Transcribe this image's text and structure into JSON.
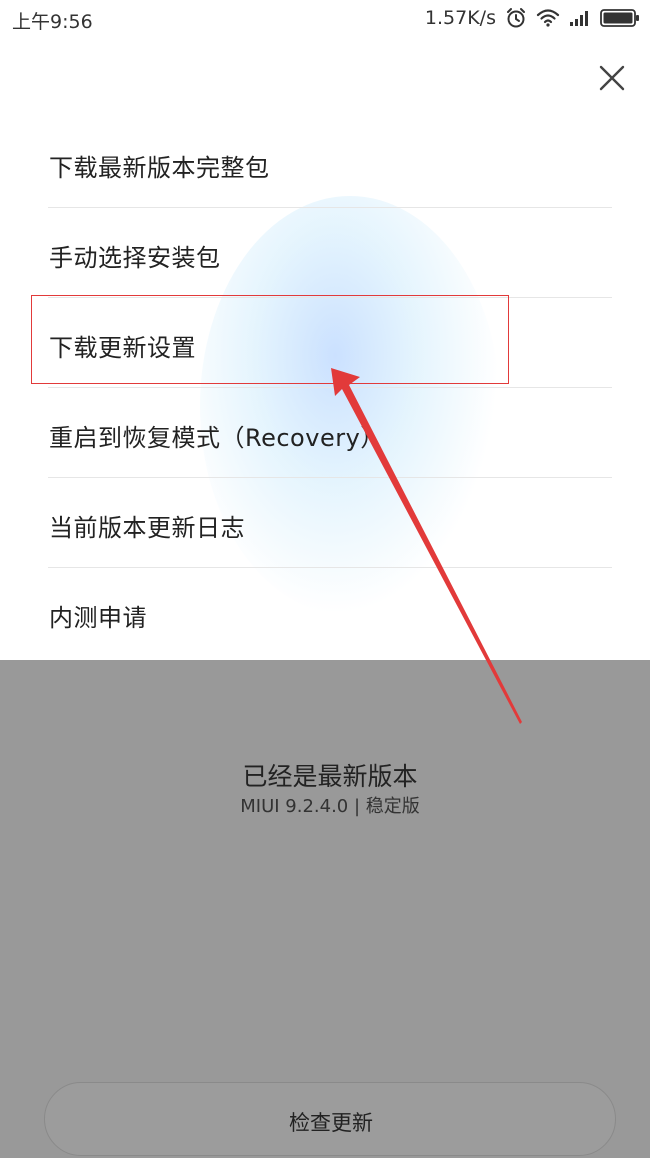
{
  "status_bar": {
    "time": "上午9:56",
    "network_speed": "1.57K/s",
    "icons": [
      "alarm-icon",
      "wifi-icon",
      "signal-icon",
      "battery-icon"
    ]
  },
  "sheet": {
    "close_icon": "close-icon",
    "menu_items": [
      "下载最新版本完整包",
      "手动选择安装包",
      "下载更新设置",
      "重启到恢复模式（Recovery）",
      "当前版本更新日志",
      "内测申请"
    ],
    "highlighted_index": 2
  },
  "info": {
    "title": "已经是最新版本",
    "version": "MIUI 9.2.4.0 | 稳定版"
  },
  "check_button": {
    "label": "检查更新"
  },
  "annotation": {
    "arrow_icon": "red-arrow-icon",
    "color": "#e23a3a"
  }
}
